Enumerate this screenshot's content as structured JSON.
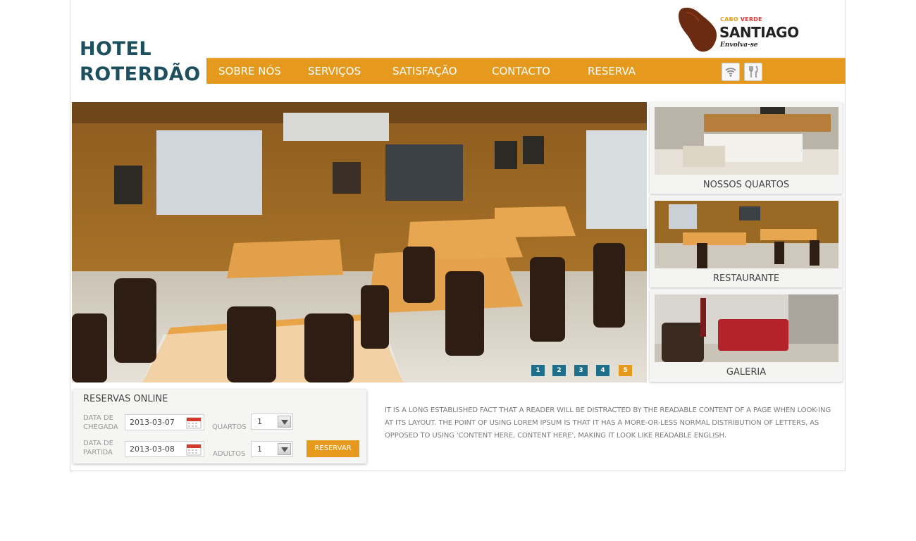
{
  "hotel": {
    "name_line1": "HOTEL",
    "name_line2": "ROTERDÃO"
  },
  "logo": {
    "top_line": [
      "CABO",
      "VERDE"
    ],
    "brand": "SANTIAGO",
    "slogan": "Envolva-se"
  },
  "nav": {
    "items": [
      "SOBRE NÓS",
      "SERVIÇOS",
      "SATISFAÇÃO",
      "CONTACTO",
      "RESERVA"
    ],
    "icons": [
      "wifi-icon",
      "restaurant-icon"
    ]
  },
  "slider": {
    "dots": [
      "1",
      "2",
      "3",
      "4",
      "5"
    ],
    "active_index": 4
  },
  "cards": [
    {
      "label": "NOSSOS QUARTOS"
    },
    {
      "label": "RESTAURANTE"
    },
    {
      "label": "GALERIA"
    }
  ],
  "booking": {
    "title": "RESERVAS ONLINE",
    "arrival_label_1": "DATA DE",
    "arrival_label_2": "CHEGADA",
    "arrival_value": "2013-03-07",
    "departure_label_1": "DATA DE",
    "departure_label_2": "PARTIDA",
    "departure_value": "2013-03-08",
    "rooms_label": "QUARTOS",
    "rooms_value": "1",
    "adults_label": "ADULTOS",
    "adults_value": "1",
    "submit_label": "RESERVAR"
  },
  "intro_text": "It is a long established fact that a reader will be distracted by the readable content of a page when look-ing at its layout. The point of using Lorem Ipsum is that it has a more-or-less normal distribution of letters, as opposed to using 'Content here, content here', making it look like readable English.",
  "colors": {
    "accent": "#e69a1d",
    "title": "#1e4f5f",
    "dot": "#1d6f8a",
    "dot_active": "#e69a1d"
  }
}
